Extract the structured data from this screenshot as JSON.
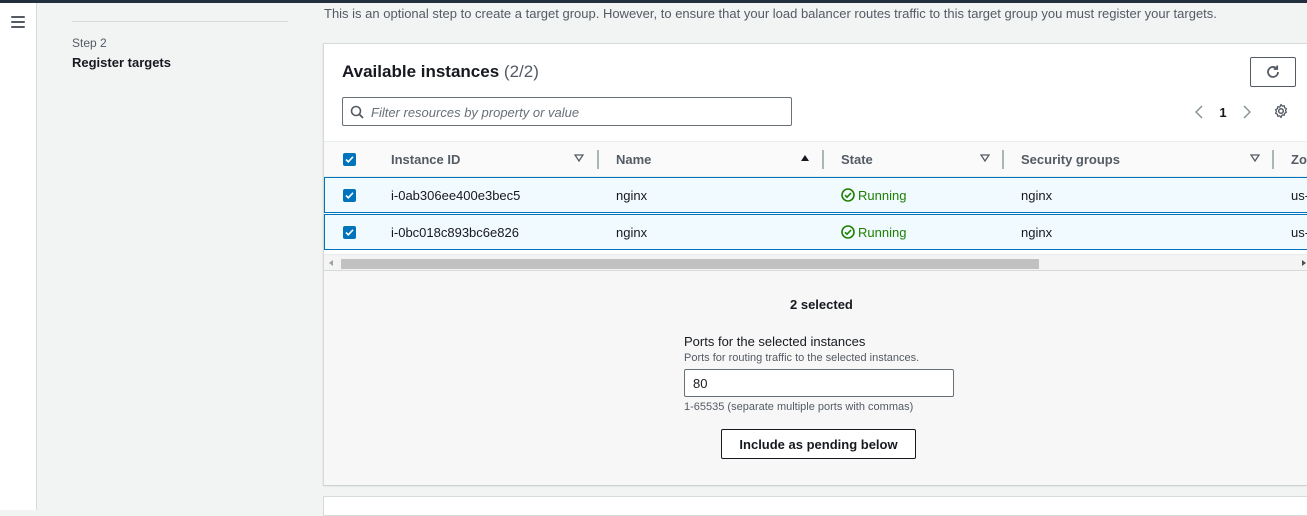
{
  "nav": {
    "menu_icon": "hamburger-menu-icon"
  },
  "steps": {
    "step_label": "Step 2",
    "step_title": "Register targets"
  },
  "intro_text": "This is an optional step to create a target group. However, to ensure that your load balancer routes traffic to this target group you must register your targets.",
  "instances": {
    "title": "Available instances",
    "count": "(2/2)",
    "refresh_icon": "refresh-icon",
    "filter_placeholder": "Filter resources by property or value",
    "page_number": "1",
    "columns": [
      "Instance ID",
      "Name",
      "State",
      "Security groups",
      "Zo"
    ],
    "sorted_column": "Name",
    "rows": [
      {
        "instance_id": "i-0ab306ee400e3bec5",
        "name": "nginx",
        "state": "Running",
        "security_groups": "nginx",
        "zone": "us-"
      },
      {
        "instance_id": "i-0bc018c893bc6e826",
        "name": "nginx",
        "state": "Running",
        "security_groups": "nginx",
        "zone": "us-"
      }
    ]
  },
  "selection": {
    "count_text": "2 selected",
    "ports_label": "Ports for the selected instances",
    "ports_desc": "Ports for routing traffic to the selected instances.",
    "ports_value": "80",
    "ports_hint": "1-65535 (separate multiple ports with commas)",
    "include_button": "Include as pending below"
  },
  "colors": {
    "accent": "#0073bb",
    "running": "#1d8102",
    "row_selected_bg": "#f1faff"
  }
}
